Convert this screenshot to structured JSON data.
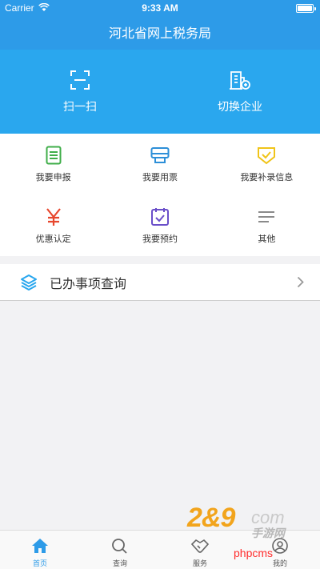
{
  "status_bar": {
    "carrier": "Carrier",
    "time": "9:33 AM",
    "battery_level": 1.0
  },
  "nav": {
    "title": "河北省网上税务局"
  },
  "hero": [
    {
      "label": "扫一扫",
      "icon": "scan-icon"
    },
    {
      "label": "切换企业",
      "icon": "building-switch-icon"
    }
  ],
  "grid": [
    {
      "label": "我要申报",
      "icon": "document-icon",
      "color": "#3fae49"
    },
    {
      "label": "我要用票",
      "icon": "printer-icon",
      "color": "#2d8fd8"
    },
    {
      "label": "我要补录信息",
      "icon": "checkmark-shield-icon",
      "color": "#f0c419"
    },
    {
      "label": "优惠认定",
      "icon": "yen-icon",
      "color": "#e7472e"
    },
    {
      "label": "我要预约",
      "icon": "calendar-check-icon",
      "color": "#6a4fc9"
    },
    {
      "label": "其他",
      "icon": "menu-lines-icon",
      "color": "#8a8a8a"
    }
  ],
  "query": {
    "label": "已办事项查询",
    "icon": "layers-icon"
  },
  "tabs": [
    {
      "label": "首页",
      "icon": "home-icon",
      "active": true
    },
    {
      "label": "查询",
      "icon": "search-icon",
      "active": false
    },
    {
      "label": "服务",
      "icon": "handshake-icon",
      "active": false
    },
    {
      "label": "我的",
      "icon": "user-icon",
      "active": false
    }
  ],
  "colors": {
    "primary": "#2d9be8",
    "hero_bg": "#2aa7ee",
    "page_bg": "#f2f2f4"
  },
  "watermark": {
    "number": "2&9",
    "domain": "com",
    "brand": "手游网",
    "site": "phpcms"
  }
}
